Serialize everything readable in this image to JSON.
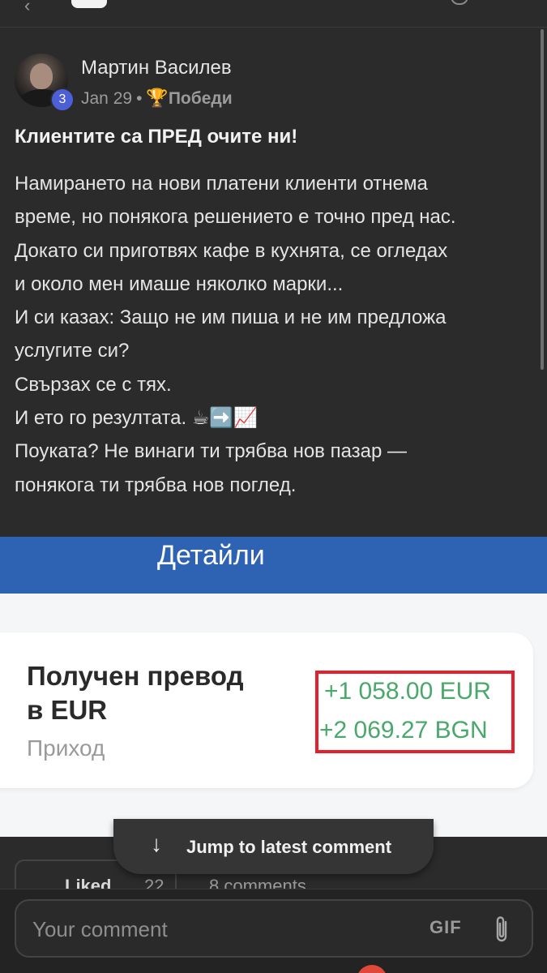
{
  "post": {
    "author": "Мартин Василев",
    "level": "3",
    "date": "Jan 29",
    "separator": "•",
    "category_icon": "🏆",
    "category": "Победи",
    "title": "Клиентите са ПРЕД очите ни!",
    "body_lines": [
      "Намирането на нови платени клиенти отнема",
      "време, но понякога решението е точно пред нас.",
      "Докато си приготвях кафе в кухнята, се огледах",
      "и около мен имаше няколко марки...",
      "И си казах: Защо не им пиша и не им предложа",
      "услугите си?",
      "Свързах се с тях.",
      "И ето го резултата. ☕➡️📈",
      "Поуката? Не винаги ти трябва нов пазар —",
      "понякога ти трябва нов поглед."
    ]
  },
  "screenshot": {
    "header": "Детайли",
    "tx_title_line1": "Получен превод",
    "tx_title_line2": "в EUR",
    "tx_type": "Приход",
    "amount_eur": "+1 058.00 EUR",
    "amount_bgn": "+2 069.27 BGN",
    "highlight_color": "#e5202e",
    "amount_color": "#4aa86b",
    "header_color": "#2d63b2"
  },
  "actions": {
    "liked_label": "Liked",
    "likes_count": "22",
    "comments_label": "8 comments"
  },
  "jump": {
    "label": "Jump to latest comment",
    "icon": "arrow-down-icon"
  },
  "comment": {
    "placeholder": "Your comment",
    "gif_label": "GIF",
    "attach_icon": "paperclip-icon"
  }
}
